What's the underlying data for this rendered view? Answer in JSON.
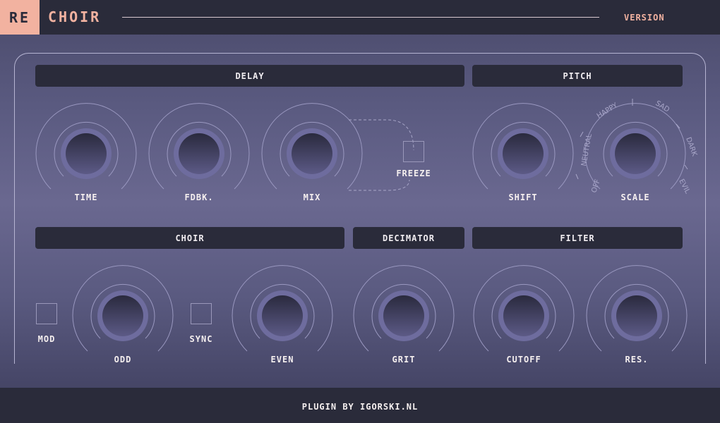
{
  "header": {
    "logo_prefix": "RE",
    "logo_name": "CHOIR",
    "version_label": "VERSION"
  },
  "sections": {
    "delay": "DELAY",
    "pitch": "PITCH",
    "choir": "CHOIR",
    "decimator": "DECIMATOR",
    "filter": "FILTER"
  },
  "knobs": {
    "time": "TIME",
    "fdbk": "FDBK.",
    "mix": "MIX",
    "shift": "SHIFT",
    "scale": "SCALE",
    "odd": "ODD",
    "even": "EVEN",
    "grit": "GRIT",
    "cutoff": "CUTOFF",
    "res": "RES."
  },
  "toggles": {
    "freeze": "FREEZE",
    "mod": "MOD",
    "sync": "SYNC"
  },
  "scale_options": [
    "OFF",
    "NEUTRAL",
    "HAPPY",
    "SAD",
    "DARK",
    "EVIL"
  ],
  "footer": {
    "credit": "PLUGIN BY IGORSKI.NL"
  },
  "colors": {
    "accent": "#f2b2a0",
    "panel_dark": "#2a2b3a",
    "knob_ring": "#6e6c9e"
  }
}
